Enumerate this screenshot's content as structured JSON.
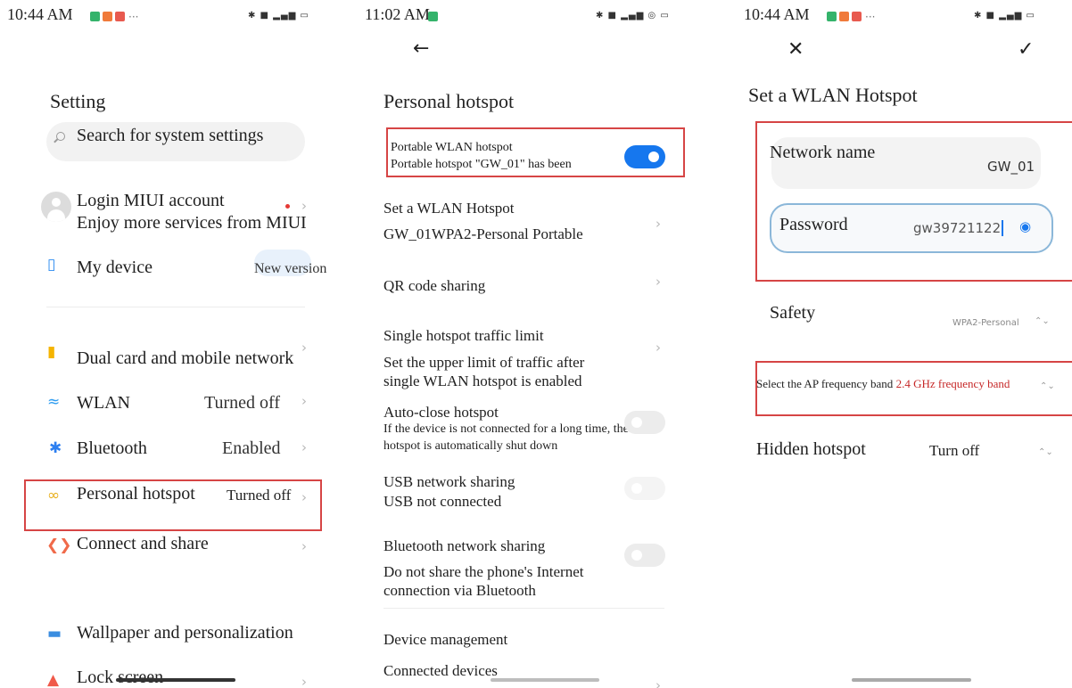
{
  "screen1": {
    "time": "10:44 AM",
    "status_icons": "✱ ■ ▂▄▆ ▭",
    "overflow": "···",
    "title": "Setting",
    "search_placeholder": "Search for system settings",
    "account": {
      "label": "Login MIUI account",
      "sub": "Enjoy more services from MIUI"
    },
    "my_device": {
      "label": "My device",
      "badge": "New version"
    },
    "items": [
      {
        "label": "Dual card and mobile network",
        "value": ""
      },
      {
        "label": "WLAN",
        "value": "Turned off"
      },
      {
        "label": "Bluetooth",
        "value": "Enabled"
      },
      {
        "label": "Personal hotspot",
        "value": "Turned off"
      },
      {
        "label": "Connect and share",
        "value": ""
      },
      {
        "label": "Wallpaper and personalization",
        "value": ""
      },
      {
        "label": "Lock screen",
        "value": ""
      }
    ],
    "chevron": "›"
  },
  "screen2": {
    "time": "11:02 AM",
    "status_icons": "✱ ■ ▂▄▆ ◎ ▭",
    "back": "←",
    "title": "Personal hotspot",
    "portable": {
      "label": "Portable WLAN hotspot",
      "sub": "Portable hotspot \"GW_01\" has been",
      "on": true
    },
    "set_hotspot": {
      "label": "Set a WLAN Hotspot",
      "sub": "GW_01WPA2-Personal Portable"
    },
    "qr": "QR code sharing",
    "traffic": {
      "label": "Single hotspot traffic limit",
      "sub": "Set the upper limit of traffic after single WLAN hotspot is enabled"
    },
    "autoclose": {
      "label": "Auto-close hotspot",
      "sub": "If the device is not connected for a long time, the hotspot is automatically shut down"
    },
    "usb": {
      "label": "USB network sharing",
      "sub": "USB not connected"
    },
    "bt": {
      "label": "Bluetooth network sharing",
      "sub": "Do not share the phone's Internet connection via Bluetooth"
    },
    "device_mgmt": "Device management",
    "connected": "Connected devices",
    "chevron": "›"
  },
  "screen3": {
    "time": "10:44 AM",
    "status_icons": "✱ ■ ▂▄▆ ▭",
    "overflow": "···",
    "close": "✕",
    "confirm": "✓",
    "title": "Set a WLAN Hotspot",
    "network_name": {
      "label": "Network name",
      "value": "GW_01"
    },
    "password": {
      "label": "Password",
      "value": "gw39721122"
    },
    "safety": {
      "label": "Safety",
      "value": "WPA2-Personal"
    },
    "band": {
      "label": "Select the AP frequency band",
      "value": "2.4 GHz frequency band"
    },
    "hidden": {
      "label": "Hidden hotspot",
      "value": "Turn off"
    },
    "updown": "⌃⌄",
    "colors": {
      "accent": "#1677ee",
      "highlight": "#d64545",
      "band_text": "#c62828"
    }
  }
}
